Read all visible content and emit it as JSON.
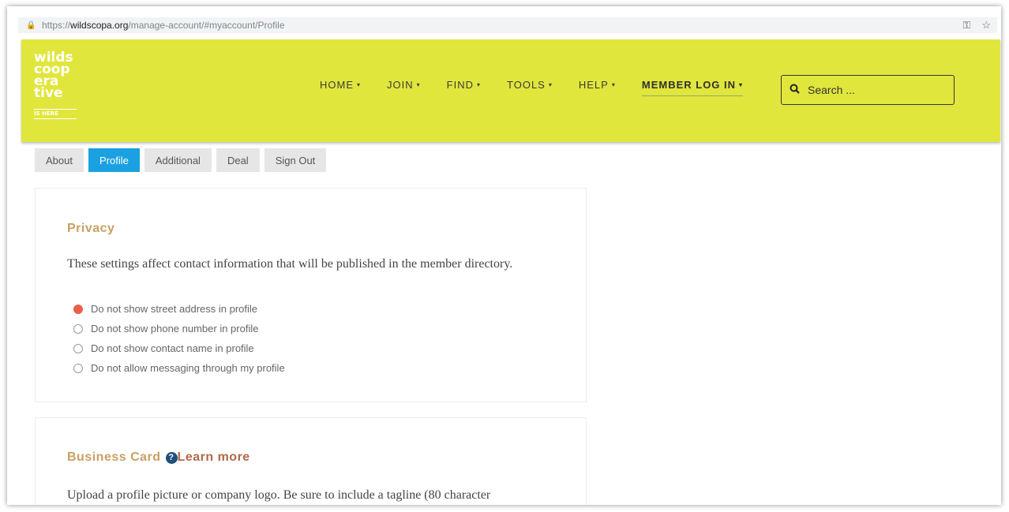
{
  "browser": {
    "url_scheme": "https://",
    "url_host": "wildscopa.org",
    "url_path": "/manage-account/#myaccount/Profile",
    "icons": [
      "lock-icon",
      "key-icon",
      "star-icon"
    ]
  },
  "logo": {
    "lines": [
      "wilds",
      "coop",
      "era",
      "tive"
    ],
    "tagline": "IS HERE"
  },
  "nav": {
    "items": [
      {
        "label": "HOME"
      },
      {
        "label": "JOIN"
      },
      {
        "label": "FIND"
      },
      {
        "label": "TOOLS"
      },
      {
        "label": "HELP"
      }
    ],
    "member": "MEMBER LOG IN",
    "caret": "▾"
  },
  "search": {
    "placeholder": "Search ..."
  },
  "tabs": [
    {
      "label": "About"
    },
    {
      "label": "Profile",
      "active": true
    },
    {
      "label": "Additional"
    },
    {
      "label": "Deal"
    },
    {
      "label": "Sign Out"
    }
  ],
  "privacy": {
    "title": "Privacy",
    "description": "These settings affect contact information that will be published in the member directory.",
    "options": [
      {
        "label": "Do not show street address in profile",
        "checked": true
      },
      {
        "label": "Do not show phone number in profile",
        "checked": false
      },
      {
        "label": "Do not show contact name in profile",
        "checked": false
      },
      {
        "label": "Do not allow messaging through my profile",
        "checked": false
      }
    ]
  },
  "business_card": {
    "title": "Business Card",
    "help_glyph": "?",
    "learn_more": "Learn more",
    "description": "Upload a profile picture or company logo. Be sure to include a tagline (80 character"
  },
  "colors": {
    "header_bg": "#e1e63c",
    "tab_active": "#1ba1e2",
    "section_title": "#c9a063",
    "radio_checked": "#e8614b"
  }
}
